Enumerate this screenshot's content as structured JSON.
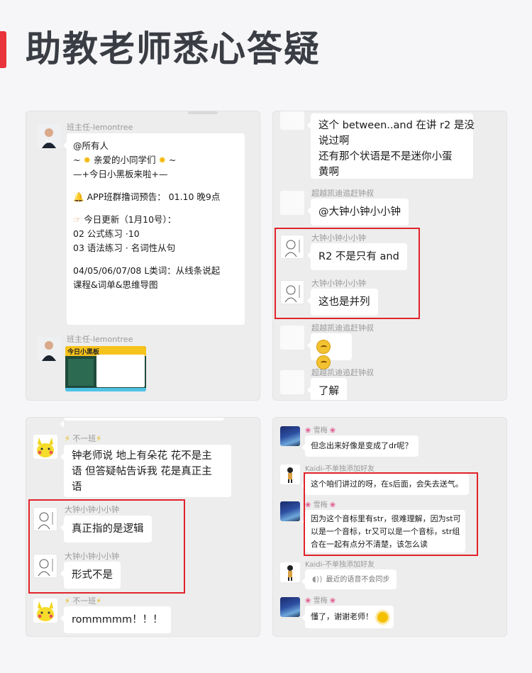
{
  "header": {
    "title": "助教老师悉心答疑"
  },
  "panel1": {
    "msg1": {
      "sender": "班主任-lemontree",
      "lines": [
        "@所有人",
        "~",
        "亲爱的小同学们",
        "~",
        "—+今日小黑板来啦+—",
        "APP班群撸词预告： 01.10  晚9点",
        "今日更新（1月10号）：",
        "02 公式练习 ·10",
        "03 语法练习 · 名词性从句",
        "04/05/06/07/08 L类词：从线条说起",
        "课程&词单&思维导图"
      ]
    },
    "msg2": {
      "sender": "班主任-lemontree",
      "image_title": "今日小黑板"
    }
  },
  "panel2": {
    "msg1": {
      "lines": [
        "这个 between..and 在讲 r2 是没",
        "说过啊",
        "还有那个状语是不是迷你小蛋",
        "黄啊"
      ]
    },
    "msg2": {
      "sender": "超越凯迪追赶钟叔",
      "text": "@大钟小钟小小钟"
    },
    "msg3": {
      "sender": "大钟小钟小小钟",
      "text": "R2 不是只有 and"
    },
    "msg4": {
      "sender": "大钟小钟小小钟",
      "text": "这也是并列"
    },
    "msg5": {
      "sender": "超越凯迪追赶钟叔"
    },
    "msg6": {
      "sender": "超越凯迪追赶钟叔",
      "text": "了解"
    }
  },
  "panel3": {
    "msg1": {
      "sender": "不一班",
      "lines": [
        "钟老师说 地上有朵花 花不是主",
        "语 但答疑帖告诉我 花是真正主",
        "语"
      ]
    },
    "msg2": {
      "sender": "大钟小钟小小钟",
      "text": "真正指的是逻辑"
    },
    "msg3": {
      "sender": "大钟小钟小小钟",
      "text": "形式不是"
    },
    "msg4": {
      "sender": "不一班",
      "text": "rommmmm！！！"
    }
  },
  "panel4": {
    "msg1": {
      "sender": "雪梅",
      "text": "但念出来好像是变成了dr呢？"
    },
    "msg2": {
      "sender": "Kaidi-不单独添加好友",
      "text": "这个咱们讲过的呀，在s后面，会失去送气。"
    },
    "msg3": {
      "sender": "雪梅",
      "lines": [
        "因为这个音标里有str，很难理解，因为st可",
        "以是一个音标，tr又可以是一个音标，str组",
        "合在一起有点分不清楚，该怎么读"
      ]
    },
    "msg4": {
      "sender": "Kaidi-不单独添加好友",
      "text": "最近的语音不会同步"
    },
    "msg5": {
      "sender": "雪梅",
      "text": "懂了，谢谢老师！"
    }
  },
  "colors": {
    "accent": "#e8343a",
    "highlight": "#e1232b",
    "panel_bg": "#ededed",
    "bubble_bg": "#ffffff"
  }
}
